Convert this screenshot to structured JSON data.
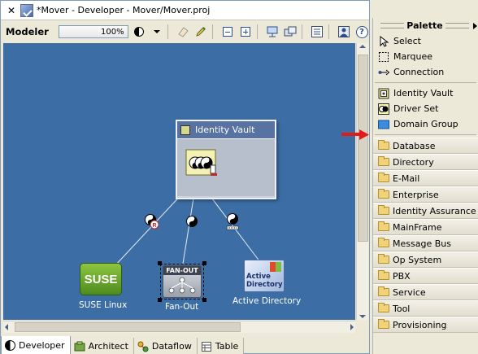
{
  "window": {
    "title": "*Mover - Developer - Mover/Mover.proj"
  },
  "toolbar": {
    "label": "Modeler",
    "zoom": "100%"
  },
  "canvas": {
    "vault": {
      "title": "Identity Vault"
    },
    "apps": [
      {
        "name": "suse-linux",
        "label": "SUSE Linux",
        "logo_text": "SUSE"
      },
      {
        "name": "fan-out",
        "label": "Fan-Out",
        "logo_text": "FAN-OUT"
      },
      {
        "name": "active-directory",
        "label": "Active Directory",
        "logo_line1": "Active",
        "logo_line2": "Directory"
      }
    ],
    "link_badges": [
      "R"
    ]
  },
  "palette": {
    "title": "Palette",
    "tools": [
      "Select",
      "Marquee",
      "Connection"
    ],
    "objects": [
      "Identity Vault",
      "Driver Set",
      "Domain Group"
    ],
    "drawers": [
      "Database",
      "Directory",
      "E-Mail",
      "Enterprise",
      "Identity Assurance",
      "MainFrame",
      "Message Bus",
      "Op System",
      "PBX",
      "Service",
      "Tool",
      "Provisioning"
    ]
  },
  "tabs": [
    "Developer",
    "Architect",
    "Dataflow",
    "Table"
  ],
  "colors": {
    "canvas_bg": "#3c6ea5",
    "vault_header": "#5873a2",
    "highlight_arrow": "#e11b1b"
  }
}
